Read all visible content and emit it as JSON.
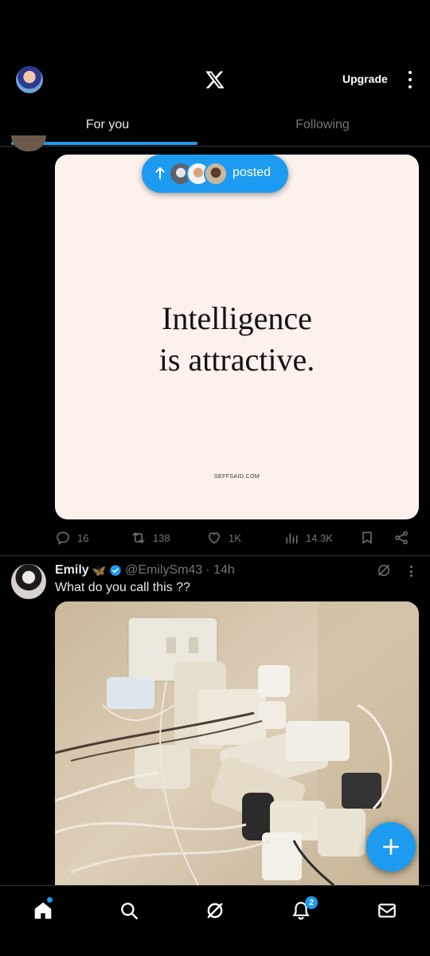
{
  "app": {
    "logo": "x-logo-icon",
    "upgrade_label": "Upgrade"
  },
  "tabs": [
    {
      "label": "For you",
      "active": true
    },
    {
      "label": "Following",
      "active": false
    }
  ],
  "post1": {
    "posted_pill_label": "posted",
    "quote_lines": [
      "Intelligence",
      "is attractive."
    ],
    "source": "SEFFSAID.COM",
    "stats": {
      "replies": "16",
      "reposts": "138",
      "likes": "1K",
      "views": "14.3K"
    }
  },
  "post2": {
    "name": "Emily",
    "emoji": "🦋",
    "handle": "@EmilySm43",
    "time": "· 14h",
    "text": "What do you call this ??"
  },
  "nav": {
    "notifications_badge": "2"
  },
  "colors": {
    "accent": "#1d9bf0",
    "background": "#000000",
    "muted": "#71767b",
    "text": "#e7e9ea"
  }
}
